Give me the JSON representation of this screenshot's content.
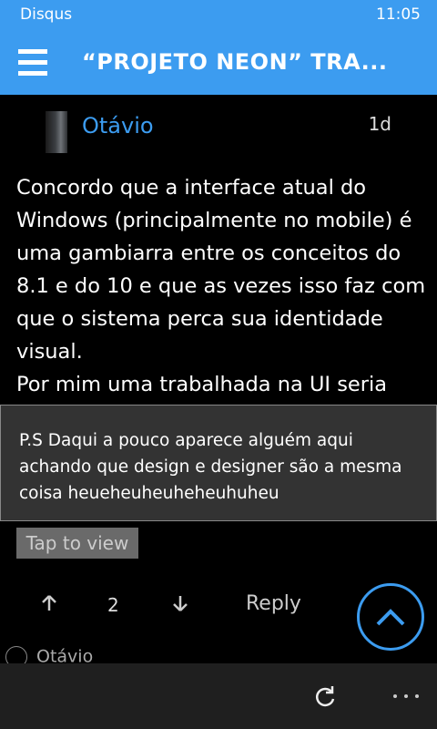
{
  "status_bar": {
    "app_name": "Disqus",
    "time": "11:05"
  },
  "header": {
    "title": "“PROJETO NEON” TRA..."
  },
  "comment": {
    "author": "Otávio",
    "age": "1d",
    "paragraph1": "Concordo que a interface atual do Windows (principalmente no mobile) é uma gambiarra entre os conceitos do 8.1 e do 10 e que as vezes isso faz com que o sistema perca sua identidade visual.",
    "paragraph2": "Por mim uma trabalhada na UI seria",
    "overlay_text": "P.S Daqui a pouco aparece alguém aqui achando que design e designer são a mesma coisa heueheuheuheheuhuheu",
    "tap_to_view": "Tap to view",
    "votes": "2",
    "reply_label": "Reply"
  },
  "next_comment": {
    "author": "Otávio"
  },
  "colors": {
    "accent": "#3c9cf0",
    "app_bar": "#1f1f1f",
    "overlay": "#333333"
  }
}
